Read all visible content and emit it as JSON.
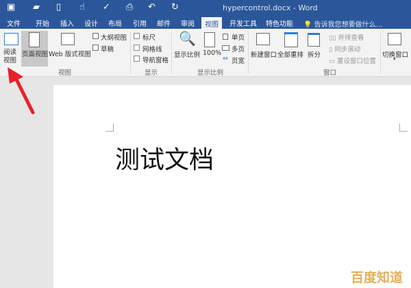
{
  "titlebar": {
    "title": "hypercontrol.docx - Word",
    "quick_access": [
      "save-icon",
      "open-icon",
      "new-icon",
      "touch-mode-icon",
      "spelling-icon",
      "print-preview-icon",
      "undo-icon",
      "redo-icon"
    ]
  },
  "tabs": [
    "文件",
    "开始",
    "插入",
    "设计",
    "布局",
    "引用",
    "邮件",
    "审阅",
    "视图",
    "开发工具",
    "特色功能"
  ],
  "active_tab": "视图",
  "tell_me": "告诉我您想要做什么...",
  "ribbon": {
    "views": {
      "read": "阅读视图",
      "print": "页面视图",
      "web": "Web 版式视图",
      "outline": "大纲视图",
      "draft": "草稿",
      "group": "视图"
    },
    "show": {
      "ruler": "标尺",
      "gridlines": "网格线",
      "nav": "导航窗格",
      "group": "显示"
    },
    "zoom": {
      "zoom": "显示比例",
      "hundred": "100%",
      "one": "单页",
      "multi": "多页",
      "width": "页宽",
      "group": "显示比例"
    },
    "window": {
      "new": "新建窗口",
      "arrange": "全部重排",
      "split": "拆分",
      "side": "并排查看",
      "sync": "同步滚动",
      "reset": "重设窗口位置",
      "switch": "切换窗口",
      "group": "窗口"
    }
  },
  "document": {
    "text": "测试文档"
  },
  "watermark": "百度知道",
  "colors": {
    "brand": "#2b579a",
    "arrow": "#e8202a"
  }
}
